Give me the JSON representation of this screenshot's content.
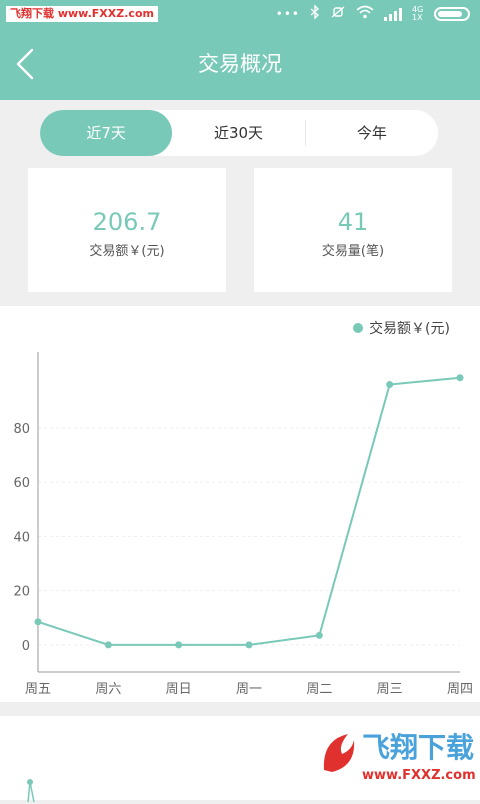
{
  "statusbar": {
    "watermark": "飞翔下载 www.FXXZ.com",
    "dots": "•••",
    "net": "4G 1X"
  },
  "header": {
    "title": "交易概况"
  },
  "tabs": [
    {
      "label": "近7天",
      "active": true
    },
    {
      "label": "近30天",
      "active": false
    },
    {
      "label": "今年",
      "active": false
    }
  ],
  "summary": {
    "amount_value": "206.7",
    "amount_label": "交易额￥(元)",
    "count_value": "41",
    "count_label": "交易量(笔)"
  },
  "chart_data": {
    "type": "line",
    "categories": [
      "周五",
      "周六",
      "周日",
      "周一",
      "周二",
      "周三",
      "周四"
    ],
    "series": [
      {
        "name": "交易额￥(元)",
        "values": [
          8.5,
          0,
          0,
          0,
          3.5,
          96,
          98.5
        ]
      }
    ],
    "yticks": [
      0,
      20,
      40,
      60,
      80
    ],
    "ylim": [
      -10,
      108
    ],
    "legend": "top-right",
    "grid": true,
    "color": "#79c9b9"
  },
  "watermark": {
    "brand": "飞翔下载",
    "url": "www.FXXZ.com"
  }
}
